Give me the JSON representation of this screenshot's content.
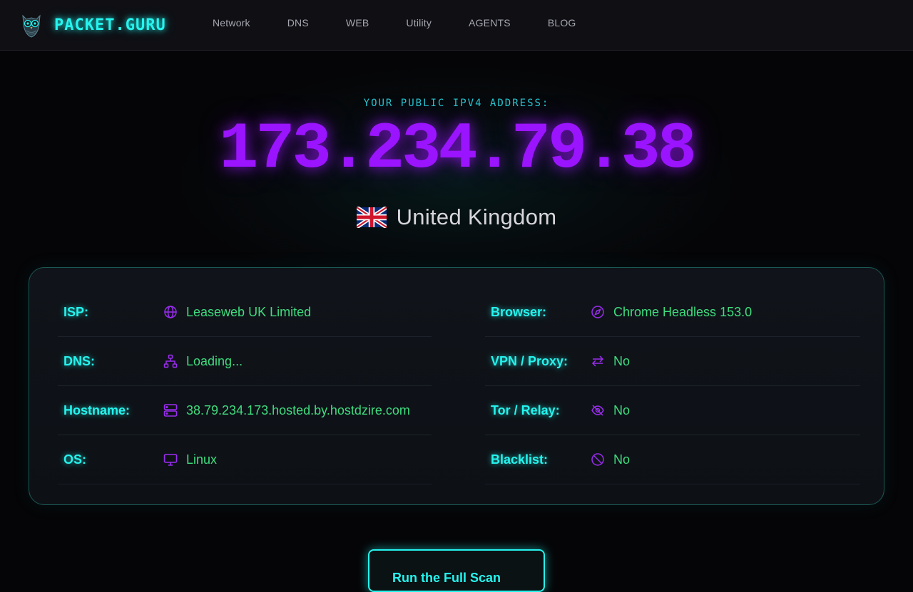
{
  "brand": {
    "name": "PACKET.GURU",
    "accent": "#25f4ee",
    "logo_icon": "owl-icon"
  },
  "nav": {
    "items": [
      "Network",
      "DNS",
      "WEB",
      "Utility",
      "AGENTS",
      "BLOG"
    ]
  },
  "hero": {
    "caption": "YOUR PUBLIC IPV4 ADDRESS:",
    "ip": "173.234.79.38",
    "ip_color": "#9b14ff",
    "country": "United Kingdom",
    "flag_icon": "uk-flag-icon"
  },
  "info": {
    "left": [
      {
        "label": "ISP:",
        "value": "Leaseweb UK Limited",
        "icon": "globe-icon"
      },
      {
        "label": "DNS:",
        "value": "Loading...",
        "icon": "network-icon"
      },
      {
        "label": "Hostname:",
        "value": "38.79.234.173.hosted.by.hostdzire.com",
        "icon": "server-icon"
      },
      {
        "label": "OS:",
        "value": "Linux",
        "icon": "monitor-icon"
      }
    ],
    "right": [
      {
        "label": "Browser:",
        "value": "Chrome Headless 153.0",
        "icon": "compass-icon"
      },
      {
        "label": "VPN / Proxy:",
        "value": "No",
        "icon": "arrows-swap-icon"
      },
      {
        "label": "Tor / Relay:",
        "value": "No",
        "icon": "eye-off-icon"
      },
      {
        "label": "Blacklist:",
        "value": "No",
        "icon": "ban-icon"
      }
    ],
    "label_color": "#25f4ee",
    "value_color": "#3fdc7e",
    "icon_color": "#9b2cf0"
  },
  "cta": {
    "label": "Run the Full Scan"
  }
}
